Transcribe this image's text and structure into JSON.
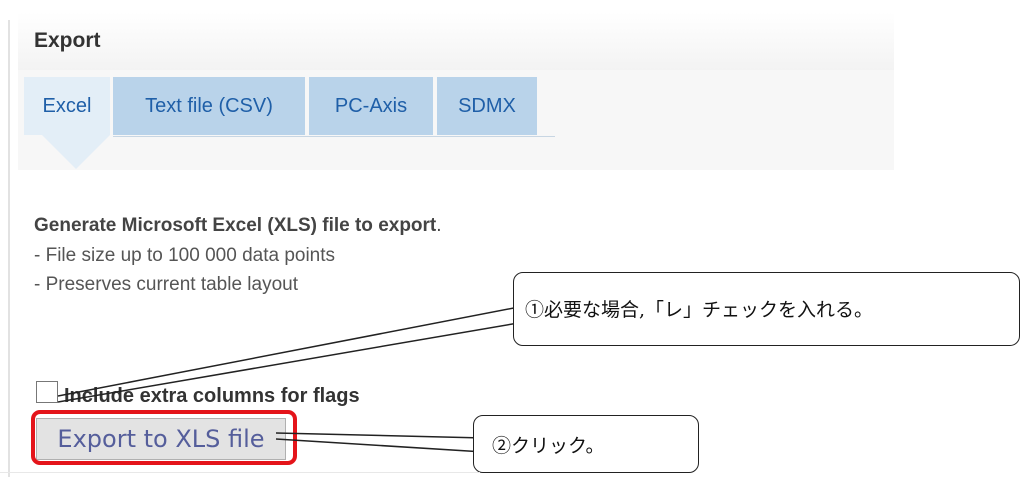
{
  "panel": {
    "title": "Export"
  },
  "tabs": [
    {
      "label": "Excel",
      "active": true
    },
    {
      "label": "Text file (CSV)",
      "active": false
    },
    {
      "label": "PC-Axis",
      "active": false
    },
    {
      "label": "SDMX",
      "active": false
    }
  ],
  "description": {
    "title": "Generate Microsoft Excel (XLS) file to export",
    "title_end": ".",
    "bullets": [
      "- File size up to 100 000 data points",
      "- Preserves current table layout"
    ]
  },
  "options": {
    "flags_checkbox_label": "Include extra columns for flags",
    "flags_checked": false
  },
  "actions": {
    "export_button_label": "Export to XLS file"
  },
  "annotations": {
    "callout_1": "①必要な場合,「レ」チェックを入れる。",
    "callout_2": "②クリック。",
    "highlight_color": "#e4141a"
  },
  "colors": {
    "tab_bg": "#b9d3ea",
    "tab_active_bg": "#e3eef7",
    "tab_text": "#1f5fa8",
    "button_text": "#555e9b"
  }
}
